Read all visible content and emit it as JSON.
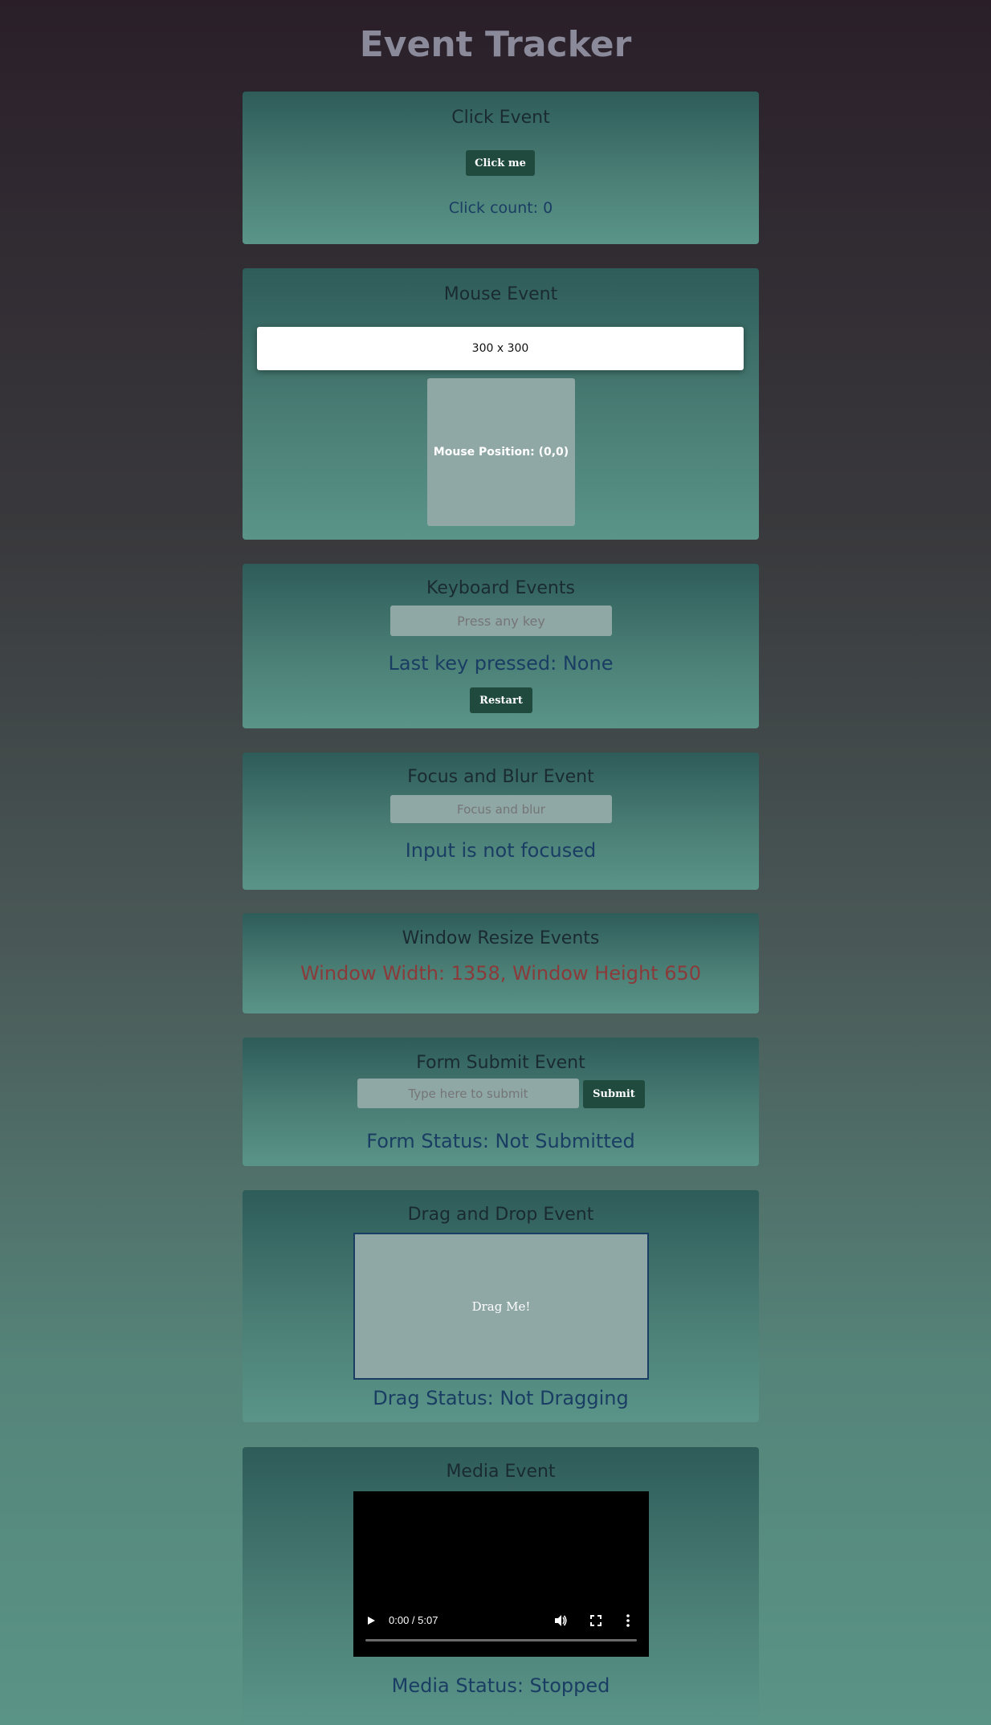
{
  "page": {
    "title": "Event Tracker"
  },
  "click_event": {
    "title": "Click Event",
    "button": "Click me",
    "status": "Click count: 0"
  },
  "mouse_event": {
    "title": "Mouse Event",
    "size": "300 x 300",
    "position": "Mouse Position: (0,0)"
  },
  "keyboard_event": {
    "title": "Keyboard Events",
    "placeholder": "Press any key",
    "status": "Last key pressed: None",
    "button": "Restart"
  },
  "focus_event": {
    "title": "Focus and Blur Event",
    "placeholder": "Focus and blur",
    "status": "Input is not focused"
  },
  "resize_event": {
    "title": "Window Resize Events",
    "status": "Window Width: 1358, Window Height 650",
    "status_color": "#8b3a3a"
  },
  "form_event": {
    "title": "Form Submit Event",
    "placeholder": "Type here to submit",
    "button": "Submit",
    "status": "Form Status: Not Submitted"
  },
  "drag_event": {
    "title": "Drag and Drop Event",
    "box": "Drag Me!",
    "status": "Drag Status: Not Dragging"
  },
  "media_event": {
    "title": "Media Event",
    "time": "0:00 / 5:07",
    "status": "Media Status: Stopped"
  },
  "colors": {
    "accent_button": "#1f4a3d",
    "status_text": "#1a3d63"
  }
}
